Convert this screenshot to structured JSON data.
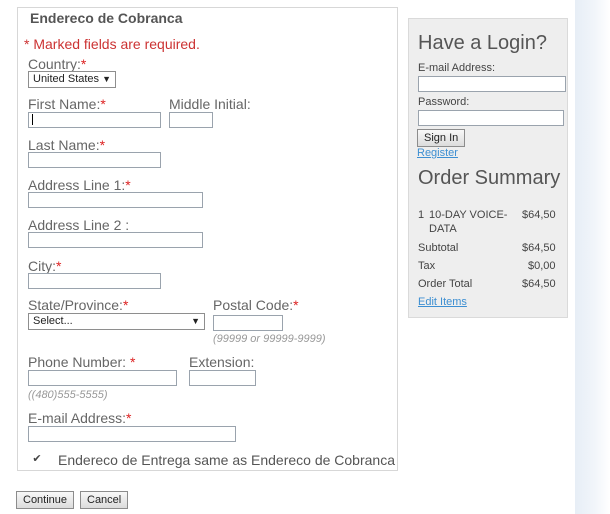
{
  "billing": {
    "legend": "Endereco de Cobranca",
    "required_note": "* Marked fields are required.",
    "country": {
      "label": "Country:",
      "required": "*",
      "value": "United States"
    },
    "first_name": {
      "label": "First Name:",
      "required": "*",
      "value": ""
    },
    "middle_initial": {
      "label": "Middle Initial:",
      "value": ""
    },
    "last_name": {
      "label": "Last Name:",
      "required": "*",
      "value": ""
    },
    "address1": {
      "label": "Address Line 1:",
      "required": "*",
      "value": ""
    },
    "address2": {
      "label": "Address Line 2 :",
      "value": ""
    },
    "city": {
      "label": "City:",
      "required": "*",
      "value": ""
    },
    "state": {
      "label": "State/Province:",
      "required": "*",
      "value": "Select..."
    },
    "postal": {
      "label": "Postal Code:",
      "required": "*",
      "hint": "(99999 or 99999-9999)",
      "value": ""
    },
    "phone": {
      "label": "Phone Number: ",
      "required": "*",
      "hint": "((480)555-5555)",
      "value": ""
    },
    "extension": {
      "label": "Extension:",
      "value": ""
    },
    "email": {
      "label": "E-mail Address:",
      "required": "*",
      "value": ""
    },
    "same_shipping": {
      "label": "Endereco de Entrega same as Endereco de Cobranca",
      "checked": true,
      "glyph": "✔"
    }
  },
  "actions": {
    "continue_label": "Continue",
    "cancel_label": "Cancel"
  },
  "login": {
    "title": "Have a Login?",
    "email_label": "E-mail Address:",
    "email_value": "",
    "password_label": "Password:",
    "password_value": "",
    "sign_in_label": "Sign In",
    "register_label": "Register"
  },
  "summary": {
    "title": "Order Summary",
    "item_qty": "1",
    "item_name_line1": "10-DAY VOICE-",
    "item_name_line2": "DATA",
    "item_price": "$64,50",
    "subtotal_label": "Subtotal",
    "subtotal_value": "$64,50",
    "tax_label": "Tax",
    "tax_value": "$0,00",
    "total_label": "Order Total",
    "total_value": "$64,50",
    "edit_items_label": "Edit Items"
  },
  "colors": {
    "required_red": "#cc3333",
    "link_blue": "#3d8fd2",
    "panel_gray": "#eeeeee"
  }
}
